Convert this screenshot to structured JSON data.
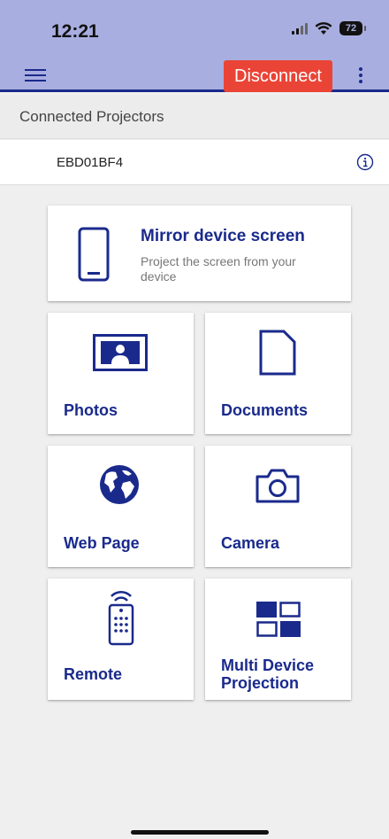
{
  "status_bar": {
    "time": "12:21",
    "battery": "72"
  },
  "toolbar": {
    "disconnect_label": "Disconnect"
  },
  "connected_section": {
    "title": "Connected Projectors"
  },
  "projector": {
    "name": "EBD01BF4"
  },
  "mirror": {
    "title": "Mirror device screen",
    "subtitle": "Project the screen from your device"
  },
  "tiles": {
    "photos": "Photos",
    "documents": "Documents",
    "web_page": "Web Page",
    "camera": "Camera",
    "remote": "Remote",
    "multi_device": "Multi Device Projection"
  },
  "colors": {
    "accent": "#1a2a8c",
    "header_bg": "#a9aee0",
    "disconnect": "#ea4436"
  }
}
